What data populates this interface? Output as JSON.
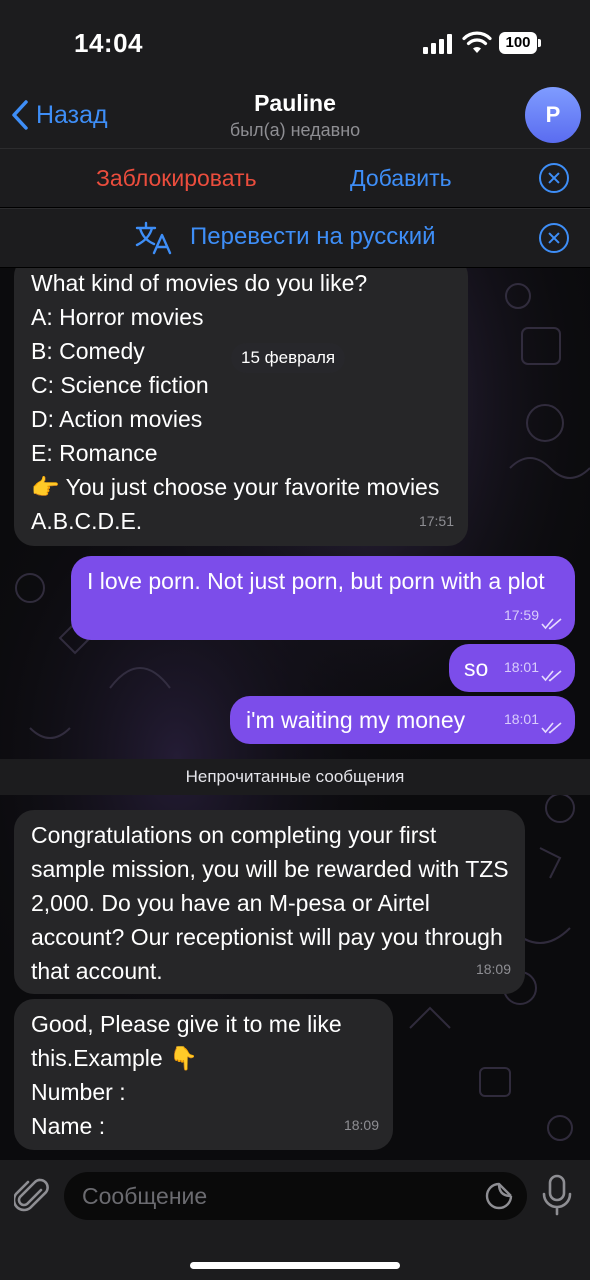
{
  "status_bar": {
    "time": "14:04",
    "battery": "100"
  },
  "header": {
    "back_label": "Назад",
    "contact_name": "Pauline",
    "contact_status": "был(а) недавно",
    "avatar_initial": "P"
  },
  "action_bar": {
    "block_label": "Заблокировать",
    "add_label": "Добавить"
  },
  "translate_bar": {
    "label": "Перевести на русский"
  },
  "date_chip": "15 февраля",
  "messages": [
    {
      "direction": "in",
      "text": "What kind of movies do you like?\nA: Horror movies\nB: Comedy\nC: Science fiction\nD: Action movies\nE: Romance\n👉  You just choose your favorite movies A.B.C.D.E.",
      "time": "17:51"
    },
    {
      "direction": "out",
      "text": "I love porn. Not just porn, but porn with a plot",
      "time": "17:59",
      "read": true
    },
    {
      "direction": "out",
      "text": "so",
      "time": "18:01",
      "read": true
    },
    {
      "direction": "out",
      "text": "i'm waiting my money",
      "time": "18:01",
      "read": true
    },
    {
      "direction": "in",
      "text": "Congratulations on completing your first sample mission, you will be rewarded with TZS 2,000. Do you have an M-pesa or Airtel account? Our receptionist will pay you through that account.",
      "time": "18:09"
    },
    {
      "direction": "in",
      "text": "Good, Please give it to me like this.Example 👇\nNumber :\nName :",
      "time": "18:09"
    }
  ],
  "unread_divider": "Непрочитанные сообщения",
  "composer": {
    "placeholder": "Сообщение"
  },
  "colors": {
    "accent": "#3e8ef7",
    "danger": "#eb4d3d",
    "outgoing_bubble": "#7c4dea",
    "incoming_bubble": "#262628"
  }
}
